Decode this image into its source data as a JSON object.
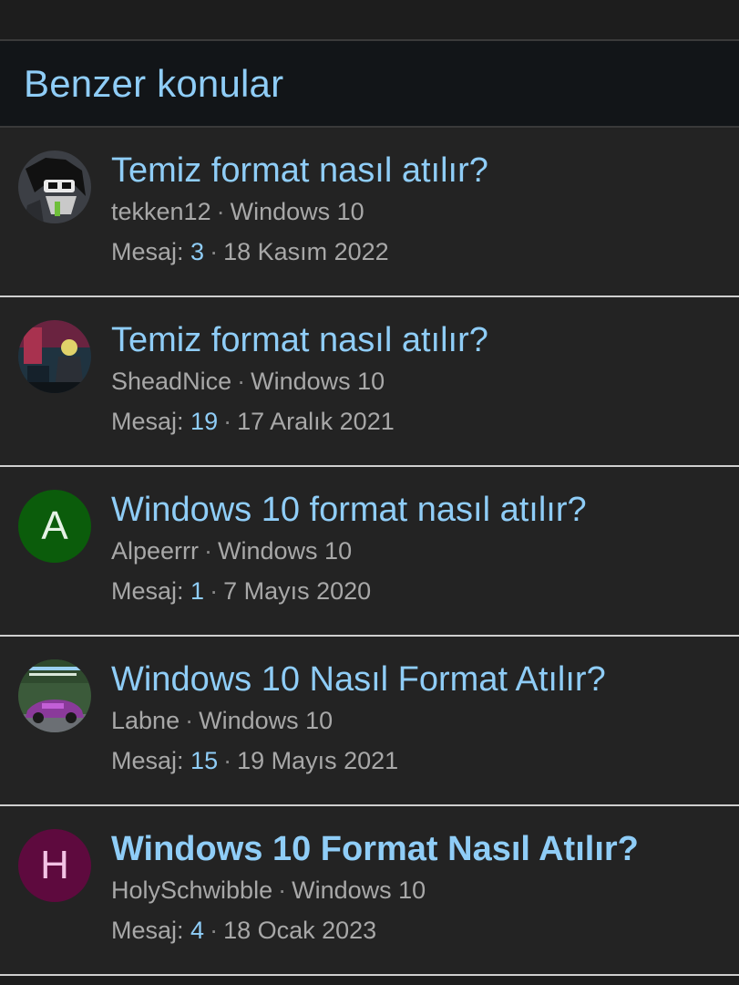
{
  "section": {
    "title": "Benzer konular"
  },
  "threads": [
    {
      "title": "Temiz format nasıl atılır?",
      "author": "tekken12",
      "forum": "Windows 10",
      "messages_label": "Mesaj:",
      "messages": "3",
      "date": "18 Kasım 2022",
      "avatar_type": "image",
      "avatar_icon": "user-photo-avatar-icon"
    },
    {
      "title": "Temiz format nasıl atılır?",
      "author": "SheadNice",
      "forum": "Windows 10",
      "messages_label": "Mesaj:",
      "messages": "19",
      "date": "17 Aralık 2021",
      "avatar_type": "image",
      "avatar_icon": "user-photo-avatar-icon"
    },
    {
      "title": "Windows 10 format nasıl atılır?",
      "author": "Alpeerrr",
      "forum": "Windows 10",
      "messages_label": "Mesaj:",
      "messages": "1",
      "date": "7 Mayıs 2020",
      "avatar_type": "letter",
      "avatar_letter": "A",
      "avatar_bg": "#0b5c0b",
      "avatar_fg": "#e6f2e6"
    },
    {
      "title": "Windows 10 Nasıl Format Atılır?",
      "author": "Labne",
      "forum": "Windows 10",
      "messages_label": "Mesaj:",
      "messages": "15",
      "date": "19 Mayıs 2021",
      "avatar_type": "image",
      "avatar_icon": "user-photo-avatar-icon"
    },
    {
      "title": "Windows 10 Format Nasıl Atılır?",
      "author": "HolySchwibble",
      "forum": "Windows 10",
      "messages_label": "Mesaj:",
      "messages": "4",
      "date": "18 Ocak 2023",
      "avatar_type": "letter",
      "avatar_letter": "H",
      "avatar_bg": "#5e0a3e",
      "avatar_fg": "#f3c2e4"
    }
  ],
  "colors": {
    "accent": "#8fcdf7",
    "background": "#232323",
    "header_bg": "#121518",
    "meta_text": "#a8a8a8"
  }
}
